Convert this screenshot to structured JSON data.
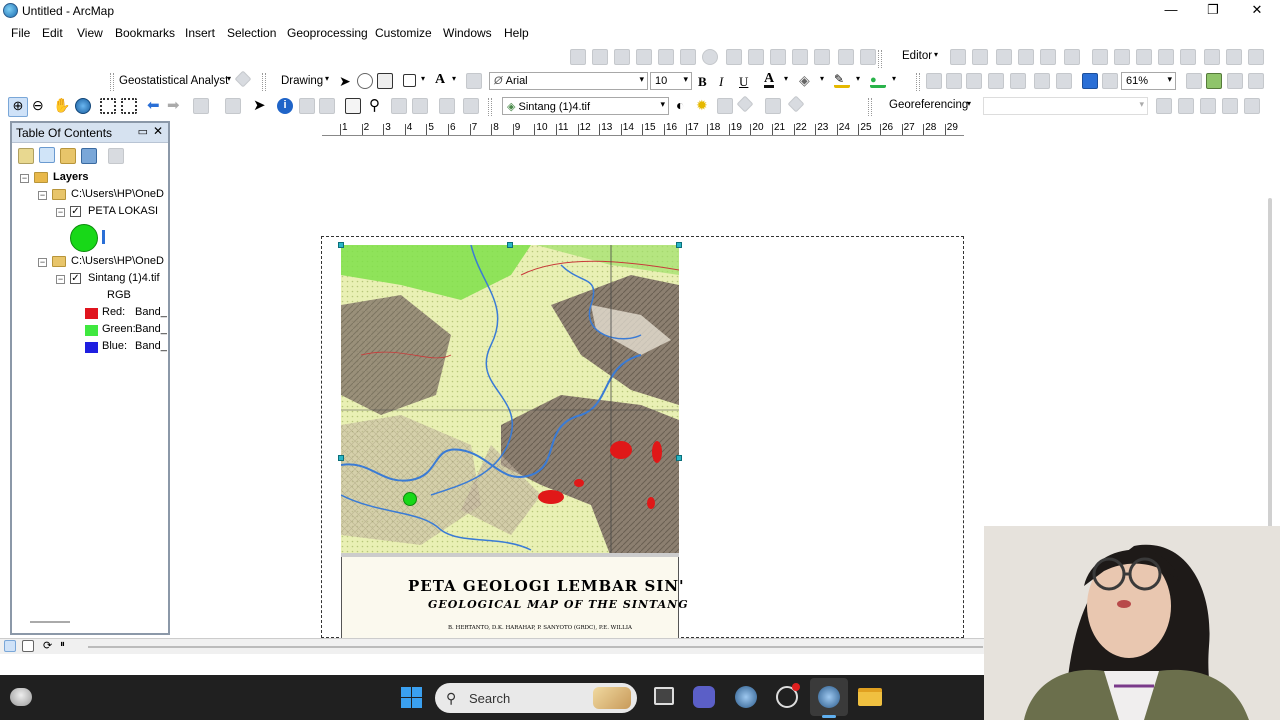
{
  "window": {
    "title": "Untitled - ArcMap",
    "min_glyph": "—",
    "max_glyph": "❐",
    "close_glyph": "✕"
  },
  "menu": [
    "File",
    "Edit",
    "View",
    "Bookmarks",
    "Insert",
    "Selection",
    "Geoprocessing",
    "Customize",
    "Windows",
    "Help"
  ],
  "toolbars": {
    "editor_label": "Editor",
    "geostat_label": "Geostatistical Analyst",
    "drawing_label": "Drawing",
    "font_name": "Arial",
    "font_size": "10",
    "bold": "B",
    "italic": "I",
    "underline": "U",
    "font_color_glyph": "A",
    "zoom_level": "61%",
    "layer_select": "Sintang (1)4.tif",
    "georef_label": "Georeferencing"
  },
  "toc": {
    "title": "Table Of Contents",
    "root": "Layers",
    "group1_path": "C:\\Users\\HP\\OneD",
    "layer1": "PETA LOKASI",
    "group2_path": "C:\\Users\\HP\\OneD",
    "layer2": "Sintang (1)4.tif",
    "rgb_label": "RGB",
    "bands": [
      {
        "label": "Red:",
        "value": "Band_",
        "color": "#e0141e"
      },
      {
        "label": "Green:",
        "value": "Band_",
        "color": "#3fe83f"
      },
      {
        "label": "Blue:",
        "value": "Band_",
        "color": "#1e1ee0"
      }
    ],
    "symbol_color": "#18d818"
  },
  "ruler": [
    "1",
    "2",
    "3",
    "4",
    "5",
    "6",
    "7",
    "8",
    "9",
    "10",
    "11",
    "12",
    "13",
    "14",
    "15",
    "16",
    "17",
    "18",
    "19",
    "20",
    "21",
    "22",
    "23",
    "24",
    "25",
    "26",
    "27",
    "28",
    "29"
  ],
  "map": {
    "title_id": "PETA GEOLOGI LEMBAR SIN'",
    "title_en": "GEOLOGICAL MAP OF THE SINTANG",
    "authors": "B. HERTANTO, D.K. HARAHAP, P. SANYOTO (GRDC), P.E. WILLIA"
  },
  "taskbar": {
    "search_placeholder": "Search"
  }
}
